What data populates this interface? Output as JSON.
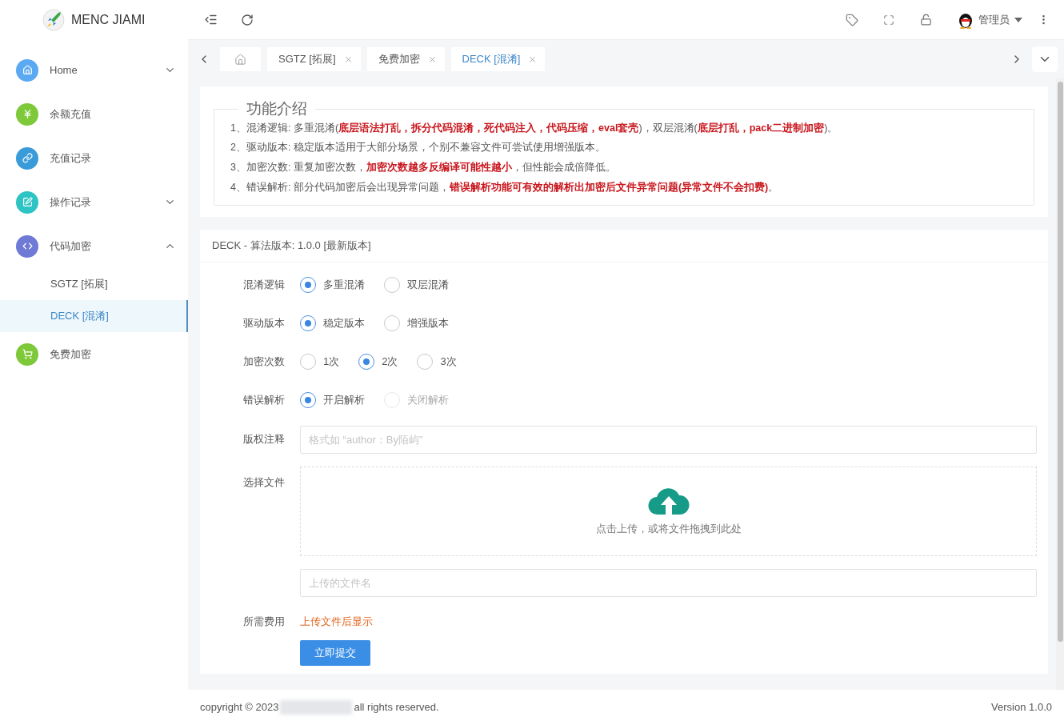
{
  "brand": {
    "title": "MENC JIAMI"
  },
  "sidebar": {
    "items": [
      {
        "label": "Home",
        "color": "#5aa9f2",
        "expanded": false
      },
      {
        "label": "余额充值",
        "color": "#7ec93a"
      },
      {
        "label": "充值记录",
        "color": "#3a9bd9"
      },
      {
        "label": "操作记录",
        "color": "#2ec4c4",
        "expanded": false
      },
      {
        "label": "代码加密",
        "color": "#6f7ad6",
        "expanded": true,
        "children": [
          {
            "label": "SGTZ [拓展]",
            "selected": false
          },
          {
            "label": "DECK [混淆]",
            "selected": true
          }
        ]
      },
      {
        "label": "免费加密",
        "color": "#7ec93a"
      }
    ]
  },
  "header": {
    "user": "管理员"
  },
  "tabs": [
    {
      "kind": "home",
      "selected": false
    },
    {
      "kind": "page",
      "label": "SGTZ [拓展]",
      "selected": false
    },
    {
      "kind": "page",
      "label": "免费加密",
      "selected": false
    },
    {
      "kind": "page",
      "label": "DECK [混淆]",
      "selected": true
    }
  ],
  "intro": {
    "title": "功能介绍",
    "lines": [
      "1、混淆逻辑: 多重混淆(**底层语法打乱，拆分代码混淆，死代码注入，代码压缩，eval套壳**)，双层混淆(**底层打乱，pack二进制加密**)。",
      "2、驱动版本: 稳定版本适用于大部分场景，个别不兼容文件可尝试使用增强版本。",
      "3、加密次数: 重复加密次数，**加密次数越多反编译可能性越小**，但性能会成倍降低。",
      "4、错误解析: 部分代码加密后会出现异常问题，**错误解析功能可有效的解析出加密后文件异常问题(异常文件不会扣费)**。"
    ]
  },
  "form": {
    "title": "DECK - 算法版本: 1.0.0 [最新版本]",
    "fields": [
      {
        "kind": "radio",
        "label": "混淆逻辑",
        "options": [
          {
            "label": "多重混淆",
            "selected": true,
            "disabled": false
          },
          {
            "label": "双层混淆",
            "selected": false,
            "disabled": false
          }
        ]
      },
      {
        "kind": "radio",
        "label": "驱动版本",
        "options": [
          {
            "label": "稳定版本",
            "selected": true,
            "disabled": false
          },
          {
            "label": "增强版本",
            "selected": false,
            "disabled": false
          }
        ]
      },
      {
        "kind": "radio",
        "label": "加密次数",
        "options": [
          {
            "label": "1次",
            "selected": false,
            "disabled": false
          },
          {
            "label": "2次",
            "selected": true,
            "disabled": false
          },
          {
            "label": "3次",
            "selected": false,
            "disabled": false
          }
        ]
      },
      {
        "kind": "radio",
        "label": "错误解析",
        "options": [
          {
            "label": "开启解析",
            "selected": true,
            "disabled": false
          },
          {
            "label": "关闭解析",
            "selected": false,
            "disabled": true
          }
        ]
      },
      {
        "kind": "text",
        "label": "版权注释",
        "placeholder": "格式如 “author：By陌屿”"
      },
      {
        "kind": "upload",
        "label": "选择文件",
        "hint": "点击上传，或将文件拖拽到此处"
      },
      {
        "kind": "text",
        "placeholder": "上传的文件名"
      },
      {
        "kind": "note",
        "label": "所需费用",
        "value": "上传文件后显示"
      }
    ],
    "submit": "立即提交"
  },
  "footer": {
    "copyright_start": "copyright © 2023",
    "copyright_end": "all rights reserved.",
    "version": "Version 1.0.0"
  }
}
